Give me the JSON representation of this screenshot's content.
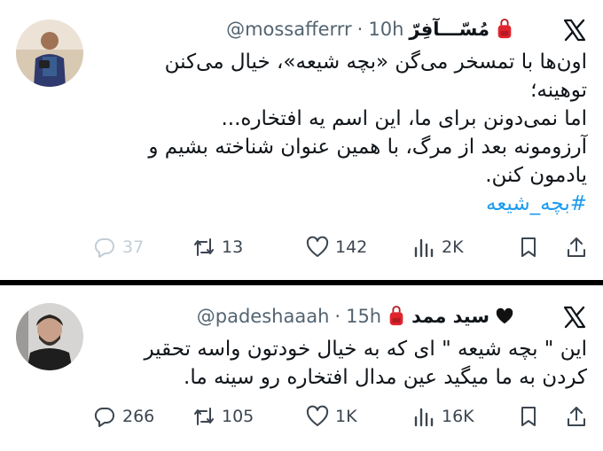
{
  "tweets": [
    {
      "display_name": "مُسّـــآفِرّ",
      "handle": "@mossafferrr",
      "separator": "·",
      "time": "10h",
      "lines": [
        "اون‌ها با تمسخر می‌گن «بچه شیعه»، خیال می‌کنن",
        "توهینه؛",
        "اما نمی‌دونن برای ما، این اسم یه افتخاره...",
        "آرزومونه بعد از مرگ، با همین عنوان شناخته بشیم و",
        "یادمون کنن."
      ],
      "hashtag": "#بچه_شیعه",
      "stats": {
        "replies": "37",
        "retweets": "13",
        "likes": "142",
        "views": "2K"
      }
    },
    {
      "display_name": "سید ممد",
      "handle": "@padeshaaah",
      "separator": "·",
      "time": "15h",
      "lines": [
        "این \" بچه شیعه \" ای که به خیال خودتون واسه تحقیر",
        "کردن به ما میگید عین مدال افتخاره رو سینه ما."
      ],
      "stats": {
        "replies": "266",
        "retweets": "105",
        "likes": "1K",
        "views": "16K"
      }
    }
  ],
  "colors": {
    "text": "#0f1419",
    "secondary": "#536471",
    "link": "#1d9bf0",
    "separator": "#000000"
  },
  "icons": [
    "x-logo-icon",
    "backpack-icon",
    "heart-emoji-icon",
    "reply-icon",
    "retweet-icon",
    "like-icon",
    "views-icon",
    "bookmark-icon",
    "share-icon"
  ]
}
